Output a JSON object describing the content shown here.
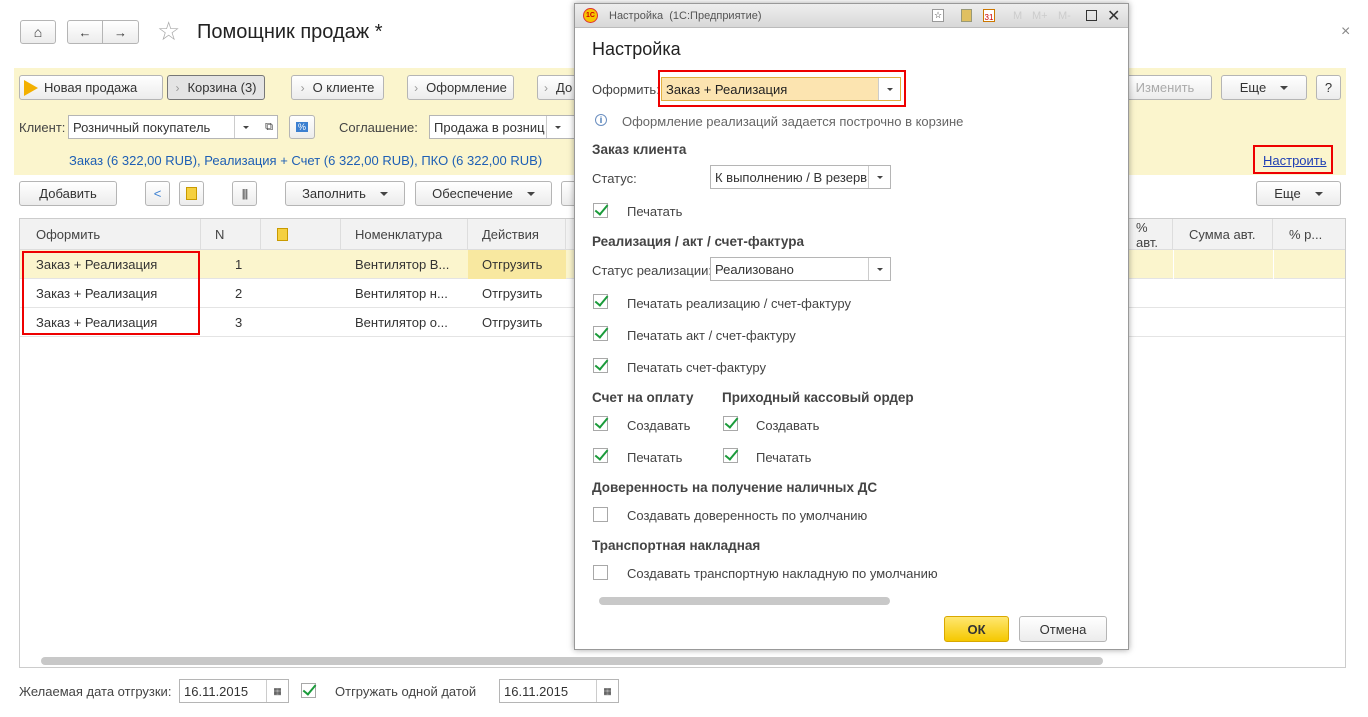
{
  "window": {
    "title": "Помощник продаж *",
    "close": "×"
  },
  "nav": {
    "home": "home-icon",
    "back": "←",
    "forward": "→",
    "star": "☆"
  },
  "steps": {
    "new_sale": "Новая продажа",
    "cart": "Корзина (3)",
    "client": "О клиенте",
    "design": "Оформление",
    "next": "До",
    "edit": "Изменить",
    "more": "Еще",
    "help": "?"
  },
  "client_row": {
    "client_label": "Клиент:",
    "client_value": "Розничный покупатель",
    "agreement_label": "Соглашение:",
    "agreement_value": "Продажа в розниц"
  },
  "summary": {
    "text": "Заказ (6 322,00 RUB), Реализация + Счет (6 322,00 RUB), ПКО (6 322,00 RUB)",
    "configure": "Настроить"
  },
  "toolbar": {
    "add": "Добавить",
    "fill": "Заполнить",
    "provision": "Обеспечение",
    "more": "Еще"
  },
  "table": {
    "headers": {
      "design": "Оформить",
      "n": "N",
      "nomenclature": "Номенклатура",
      "actions": "Действия",
      "pct_auto": "% авт.",
      "sum_auto": "Сумма авт.",
      "pct_r": "% р..."
    },
    "rows": [
      {
        "design": "Заказ + Реализация",
        "n": "1",
        "nomenclature": "Вентилятор В...",
        "actions": "Отгрузить"
      },
      {
        "design": "Заказ + Реализация",
        "n": "2",
        "nomenclature": "Вентилятор н...",
        "actions": "Отгрузить"
      },
      {
        "design": "Заказ + Реализация",
        "n": "3",
        "nomenclature": "Вентилятор о...",
        "actions": "Отгрузить"
      }
    ]
  },
  "bottom": {
    "date_label": "Желаемая дата отгрузки:",
    "date_value": "16.11.2015",
    "one_date_label": "Отгружать одной датой",
    "one_date_value": "16.11.2015"
  },
  "dialog": {
    "titlebar": "Настройка  (1С:Предприятие)",
    "tb_buttons": {
      "m": "M",
      "mplus": "M+",
      "mminus": "M-"
    },
    "heading": "Настройка",
    "design_label": "Оформить:",
    "design_value": "Заказ + Реализация",
    "info": "Оформление реализаций задается построчно в корзине",
    "order": {
      "title": "Заказ клиента",
      "status_label": "Статус:",
      "status_value": "К выполнению / В резерв",
      "print": "Печатать"
    },
    "sale": {
      "title": "Реализация / акт / счет-фактура",
      "status_label": "Статус реализации:",
      "status_value": "Реализовано",
      "print_sale": "Печатать реализацию / счет-фактуру",
      "print_act": "Печатать акт / счет-фактуру",
      "print_invoice": "Печатать счет-фактуру"
    },
    "bill": {
      "title": "Счет на оплату",
      "create": "Создавать",
      "print": "Печатать"
    },
    "cash": {
      "title": "Приходный кассовый ордер",
      "create": "Создавать",
      "print": "Печатать"
    },
    "proxy": {
      "title": "Доверенность на получение наличных ДС",
      "create": "Создавать доверенность по умолчанию"
    },
    "transport": {
      "title": "Транспортная накладная",
      "create": "Создавать транспортную накладную по умолчанию"
    },
    "ok": "ОК",
    "cancel": "Отмена"
  }
}
